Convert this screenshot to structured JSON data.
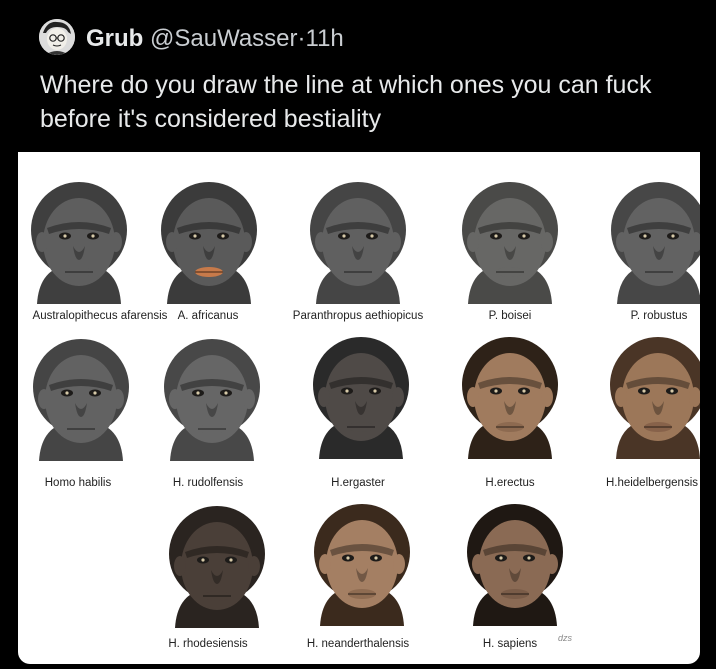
{
  "post": {
    "author_name": "Grub",
    "author_handle": "@SauWasser",
    "separator": "·",
    "time": "11h",
    "text": "Where do you draw the line at which ones you can fuck before it's considered bestiality"
  },
  "media": {
    "watermark": "dzs",
    "specimens": [
      {
        "label": "Australopithecus afarensis",
        "skin": "#5e5e5e",
        "hair": "#3f3f3f",
        "lip": "#5e5e5e"
      },
      {
        "label": "A. africanus",
        "skin": "#5a5a5a",
        "hair": "#3b3b3b",
        "lip": "#c77a4a"
      },
      {
        "label": "Paranthropus aethiopicus",
        "skin": "#606060",
        "hair": "#454545",
        "lip": "#606060"
      },
      {
        "label": "P. boisei",
        "skin": "#676765",
        "hair": "#4a4a48",
        "lip": "#676765"
      },
      {
        "label": "P. robustus",
        "skin": "#626262",
        "hair": "#474747",
        "lip": "#626262"
      },
      {
        "label": "Homo habilis",
        "skin": "#626262",
        "hair": "#454545",
        "lip": "#626262"
      },
      {
        "label": "H. rudolfensis",
        "skin": "#666666",
        "hair": "#484848",
        "lip": "#666666"
      },
      {
        "label": "H.ergaster",
        "skin": "#4f4a47",
        "hair": "#2a2a2a",
        "lip": "#4f4a47"
      },
      {
        "label": "H.erectus",
        "skin": "#a07b5e",
        "hair": "#2e2218",
        "lip": "#8d6a50"
      },
      {
        "label": "H.heidelbergensis",
        "skin": "#9c7759",
        "hair": "#4a3526",
        "lip": "#87624a"
      },
      {
        "label": "H. rhodesiensis",
        "skin": "#4a3f38",
        "hair": "#2a2420",
        "lip": "#4a3f38"
      },
      {
        "label": "H. neanderthalensis",
        "skin": "#a47f63",
        "hair": "#3b2a1d",
        "lip": "#8f6c52"
      },
      {
        "label": "H. sapiens",
        "skin": "#8a6a54",
        "hair": "#1f1813",
        "lip": "#7a5c48"
      }
    ]
  }
}
